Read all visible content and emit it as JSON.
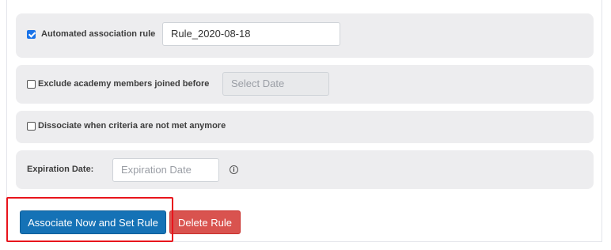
{
  "rules": {
    "automated": {
      "checked": true,
      "label": "Automated association rule",
      "value": "Rule_2020-08-18"
    },
    "exclude": {
      "checked": false,
      "label": "Exclude academy members joined before",
      "placeholder": "Select Date"
    },
    "dissociate": {
      "checked": false,
      "label": "Dissociate when criteria are not met anymore"
    },
    "expiration": {
      "label": "Expiration Date:",
      "placeholder": "Expiration Date",
      "info_icon": "info-icon"
    }
  },
  "actions": {
    "associate_label": "Associate Now and Set Rule",
    "delete_label": "Delete Rule"
  },
  "colors": {
    "primary": "#1572b6",
    "danger": "#d9534f",
    "highlight": "#e8141c",
    "row_bg": "#ededef"
  }
}
